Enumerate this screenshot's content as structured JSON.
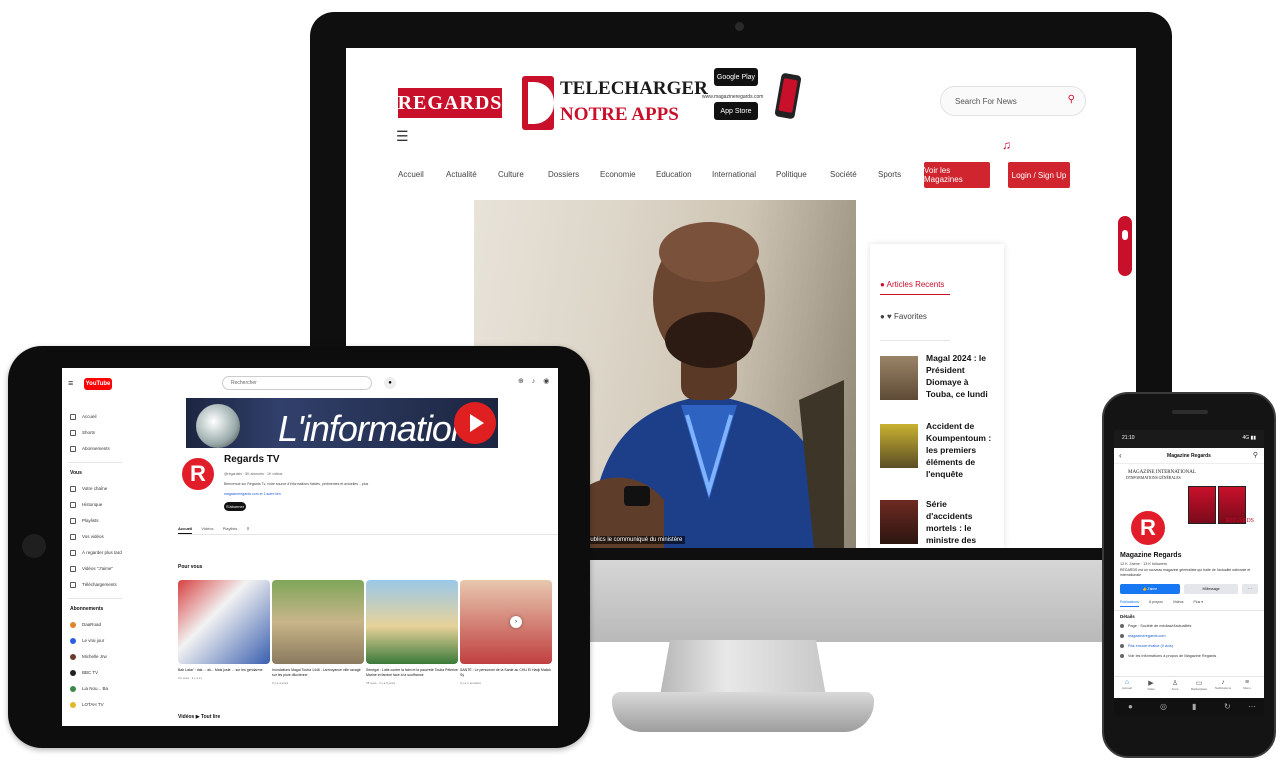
{
  "monitor": {
    "site_logo": "REGARDS",
    "download_line1": "TELECHARGER",
    "download_line2": "NOTRE APPS",
    "store_google": "Google Play",
    "store_apple": "App Store",
    "store_url": "www.magazineregards.com",
    "search_placeholder": "Search For News",
    "nav": [
      "Accueil",
      "Actualité",
      "Culture",
      "Dossiers",
      "Economie",
      "Education",
      "International",
      "Politique",
      "Société",
      "Sports"
    ],
    "btn_magazines": "Voir les Magazines",
    "btn_login": "Login / Sign Up",
    "hero_caption": "publics le communiqué du ministère",
    "sidebar": {
      "recent_title": "Articles Recents",
      "favorites_title": "Favorites",
      "articles": [
        "Magal 2024 : le Président Diomaye à Touba, ce lundi",
        "Accident de Koumpentoum : les premiers éléments de l'enquête",
        "Série d'accidents mortels : le ministre des Transports"
      ]
    }
  },
  "tablet": {
    "youtube_logo": "YouTube",
    "search_placeholder": "Rechercher",
    "sidebar_top": [
      "Accueil",
      "Shorts",
      "Abonnements"
    ],
    "sidebar_you_head": "Vous",
    "sidebar_you": [
      "Votre chaîne",
      "Historique",
      "Playlists",
      "Vos vidéos",
      "À regarder plus tard",
      "Vidéos \"J'aime\"",
      "Téléchargements"
    ],
    "sidebar_subs_head": "Abonnements",
    "sidebar_subs": [
      "DaaRoad",
      "Le vrai jour",
      "Michelle Jrw",
      "BBC TV",
      "Lia Nou... Ba",
      "LOTAH TV"
    ],
    "banner_text": "L'information",
    "channel": {
      "avatar_letter": "R",
      "name": "Regards TV",
      "meta": "@regardstv · 5K abonnés · 1K vidéos",
      "description": "Bienvenue sur Regards Tv, votre source d'informations fiables, pertinentes et actuelles ...plus",
      "link": "magazineregards.com et 1 autre lien",
      "subscribe": "S'abonner",
      "tabs": [
        "Accueil",
        "Vidéos",
        "Playlists"
      ],
      "section_for_you": "Pour vous",
      "section_videos": "Vidéos ▶ Tout lire"
    },
    "videos": [
      {
        "title": "Bah Latar' : dak ... ak... Mais juste ... sur les gendarme",
        "meta": "3 k vues · il y a 2 j"
      },
      {
        "title": "Inondations Magal Touba 1446 : Larmoyance ville ravagé sur les pluie diluvienne",
        "meta": "Il y a 4 jours"
      },
      {
        "title": "Sénégal : Lutte contre la faim et la pauvreté Touba Pèlerine Marine et famine face à la souffrance",
        "meta": "78 vues · il y a 5 jours"
      },
      {
        "title": "SANTÉ : Le personnel de la Santé au CHU El Hadji Malick Sy",
        "meta": "Il y a 1 semaine"
      }
    ]
  },
  "phone": {
    "time": "21:10",
    "status_right": "4G ▮▮",
    "page_title": "Magazine Regards",
    "cover_line1": "MAGAZINE INTERNATIONAL",
    "cover_line2": "D'INFORMATIONS GÉNÉRALES",
    "cover_brand": "REGARDS",
    "avatar_letter": "R",
    "name": "Magazine Regards",
    "stats": "12 K J'aime · 13 K followers",
    "description": "REGARDS est un nouveau magazine généraliste qui traite de l'actualité nationale et internationale",
    "btn_like": "J'aime",
    "btn_message": "Message",
    "btn_more": "···",
    "tabs": [
      "Publications",
      "À propos",
      "Vidéos",
      "Plus ▾"
    ],
    "section_head": "Détails",
    "details": [
      "Page · Société de médias/d'actualités",
      "magazineregards.com",
      "Pas encore évalué (0 avis)",
      "Voir les informations à propos de Magazine Regards"
    ],
    "nav": [
      "Accueil",
      "Vidéo",
      "Amis",
      "Marketplace",
      "Notifications",
      "Menu"
    ]
  },
  "colors": {
    "brand_red": "#c9102b",
    "nav_button_red": "#d0242e",
    "youtube_red": "#ff0000",
    "facebook_blue": "#1877f2"
  }
}
